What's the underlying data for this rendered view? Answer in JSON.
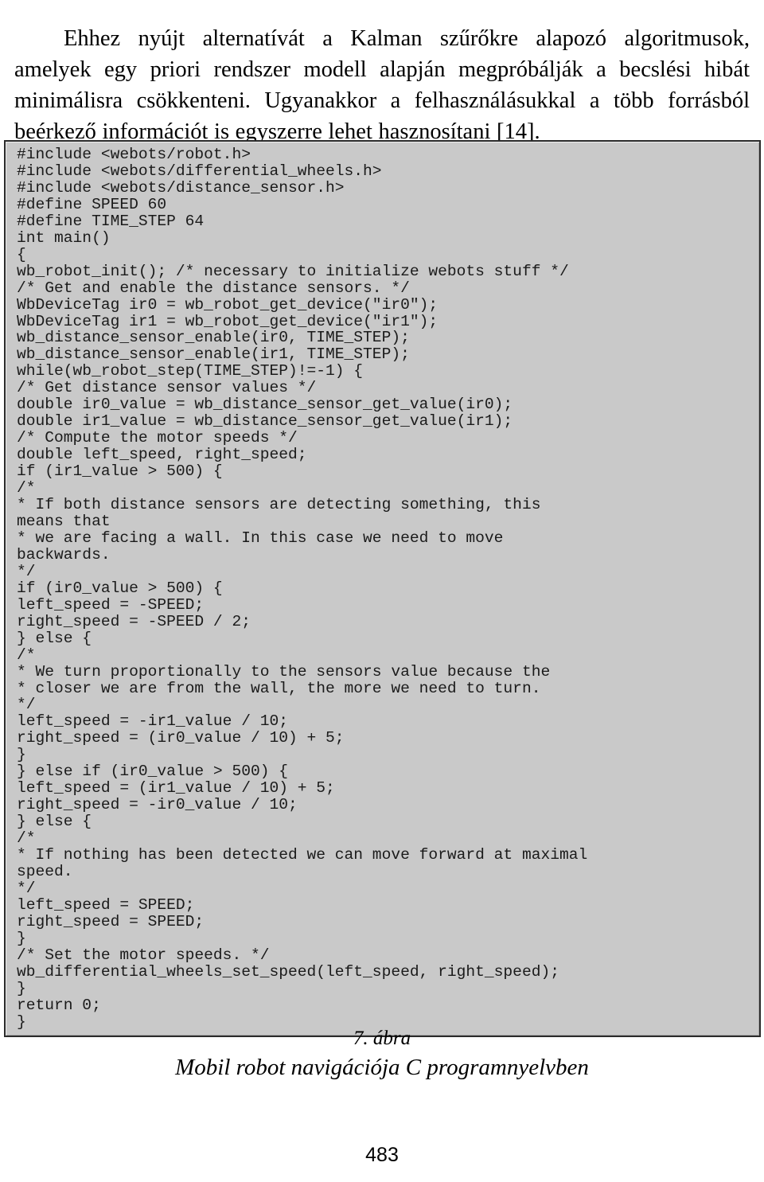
{
  "document": {
    "page_number": "483",
    "paragraph": "Ehhez nyújt alternatívát a Kalman szűrőkre alapozó algoritmusok, amelyek egy priori rendszer modell alapján megpróbálják a becslési hibát minimálisra csökkenteni. Ugyanakkor a felhasználásukkal a több forrásból beérkező információt is egyszerre lehet hasznosítani [14]."
  },
  "figure": {
    "caption_number": "7. ábra",
    "caption_title": "Mobil robot navigációja C programnyelvben",
    "background_color": "#c9c9c9",
    "border_color": "#2b2b2b",
    "language": "C",
    "code_lines": [
      "#include <webots/robot.h>",
      "#include <webots/differential_wheels.h>",
      "#include <webots/distance_sensor.h>",
      "#define SPEED 60",
      "#define TIME_STEP 64",
      "int main()",
      "{",
      "wb_robot_init(); /* necessary to initialize webots stuff */",
      "/* Get and enable the distance sensors. */",
      "WbDeviceTag ir0 = wb_robot_get_device(\"ir0\");",
      "WbDeviceTag ir1 = wb_robot_get_device(\"ir1\");",
      "wb_distance_sensor_enable(ir0, TIME_STEP);",
      "wb_distance_sensor_enable(ir1, TIME_STEP);",
      "while(wb_robot_step(TIME_STEP)!=-1) {",
      "/* Get distance sensor values */",
      "double ir0_value = wb_distance_sensor_get_value(ir0);",
      "double ir1_value = wb_distance_sensor_get_value(ir1);",
      "/* Compute the motor speeds */",
      "double left_speed, right_speed;",
      "if (ir1_value > 500) {",
      "/*",
      "* If both distance sensors are detecting something, this",
      "means that",
      "* we are facing a wall. In this case we need to move",
      "backwards.",
      "*/",
      "if (ir0_value > 500) {",
      "left_speed = -SPEED;",
      "right_speed = -SPEED / 2;",
      "} else {",
      "/*",
      "* We turn proportionally to the sensors value because the",
      "* closer we are from the wall, the more we need to turn.",
      "*/",
      "left_speed = -ir1_value / 10;",
      "right_speed = (ir0_value / 10) + 5;",
      "}",
      "} else if (ir0_value > 500) {",
      "left_speed = (ir1_value / 10) + 5;",
      "right_speed = -ir0_value / 10;",
      "} else {",
      "/*",
      "* If nothing has been detected we can move forward at maximal",
      "speed.",
      "*/",
      "left_speed = SPEED;",
      "right_speed = SPEED;",
      "}",
      "/* Set the motor speeds. */",
      "wb_differential_wheels_set_speed(left_speed, right_speed);",
      "}",
      "return 0;",
      "}"
    ]
  }
}
